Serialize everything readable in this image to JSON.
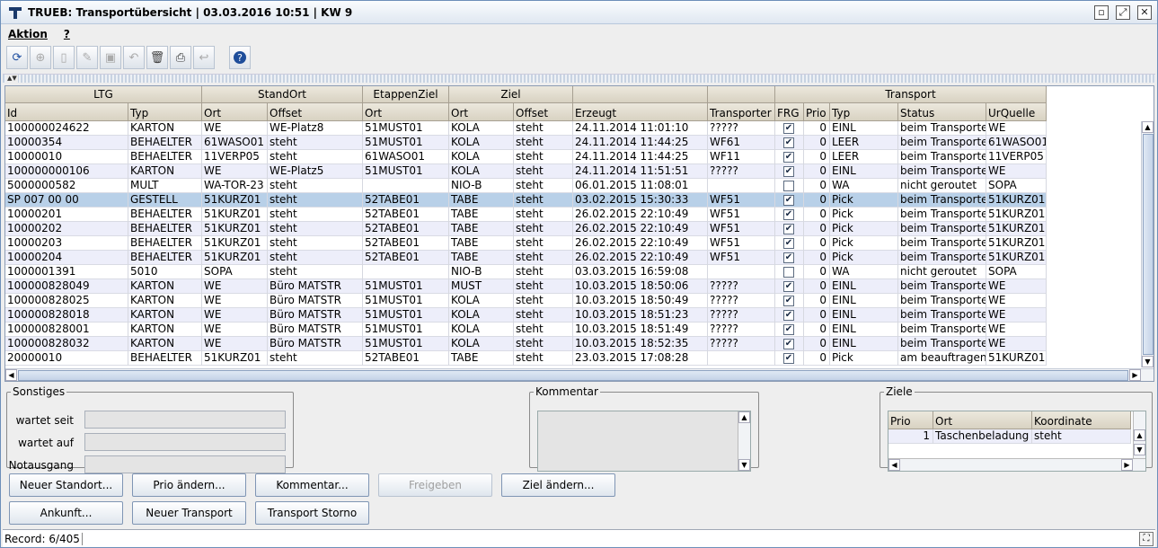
{
  "window": {
    "title": "TRUEB: Transportübersicht | 03.03.2016 10:51 | KW 9"
  },
  "menu": [
    "Aktion",
    "?"
  ],
  "table": {
    "group_headers": [
      "LTG",
      "StandOrt",
      "EtappenZiel",
      "Ziel",
      "Transport"
    ],
    "columns": [
      "Id",
      "Typ",
      "Ort",
      "Offset",
      "Ort",
      "Ort",
      "Offset",
      "Erzeugt",
      "Transporter",
      "FRG",
      "Prio",
      "Typ",
      "Status",
      "UrQuelle"
    ],
    "rows": [
      [
        "100000024622",
        "KARTON",
        "WE",
        "WE-Platz8",
        "51MUST01",
        "KOLA",
        "steht",
        "24.11.2014 11:01:10",
        "?????",
        true,
        "0",
        "EINL",
        "beim Transporter",
        "WE"
      ],
      [
        "10000354",
        "BEHAELTER",
        "61WASO01",
        "steht",
        "51MUST01",
        "KOLA",
        "steht",
        "24.11.2014 11:44:25",
        "WF61",
        true,
        "0",
        "LEER",
        "beim Transporter",
        "61WASO01"
      ],
      [
        "10000010",
        "BEHAELTER",
        "11VERP05",
        "steht",
        "61WASO01",
        "KOLA",
        "steht",
        "24.11.2014 11:44:25",
        "WF11",
        true,
        "0",
        "LEER",
        "beim Transporter",
        "11VERP05"
      ],
      [
        "100000000106",
        "KARTON",
        "WE",
        "WE-Platz5",
        "51MUST01",
        "KOLA",
        "steht",
        "24.11.2014 11:51:51",
        "?????",
        true,
        "0",
        "EINL",
        "beim Transporter",
        "WE"
      ],
      [
        "5000000582",
        "MULT",
        "WA-TOR-23",
        "steht",
        "",
        "NIO-B",
        "steht",
        "06.01.2015 11:08:01",
        "",
        false,
        "0",
        "WA",
        "nicht geroutet",
        "SOPA"
      ],
      [
        "SP 007 00 00",
        "GESTELL",
        "51KURZ01",
        "steht",
        "52TABE01",
        "TABE",
        "steht",
        "03.02.2015 15:30:33",
        "WF51",
        true,
        "0",
        "Pick",
        "beim Transporter",
        "51KURZ01"
      ],
      [
        "10000201",
        "BEHAELTER",
        "51KURZ01",
        "steht",
        "52TABE01",
        "TABE",
        "steht",
        "26.02.2015 22:10:49",
        "WF51",
        true,
        "0",
        "Pick",
        "beim Transporter",
        "51KURZ01"
      ],
      [
        "10000202",
        "BEHAELTER",
        "51KURZ01",
        "steht",
        "52TABE01",
        "TABE",
        "steht",
        "26.02.2015 22:10:49",
        "WF51",
        true,
        "0",
        "Pick",
        "beim Transporter",
        "51KURZ01"
      ],
      [
        "10000203",
        "BEHAELTER",
        "51KURZ01",
        "steht",
        "52TABE01",
        "TABE",
        "steht",
        "26.02.2015 22:10:49",
        "WF51",
        true,
        "0",
        "Pick",
        "beim Transporter",
        "51KURZ01"
      ],
      [
        "10000204",
        "BEHAELTER",
        "51KURZ01",
        "steht",
        "52TABE01",
        "TABE",
        "steht",
        "26.02.2015 22:10:49",
        "WF51",
        true,
        "0",
        "Pick",
        "beim Transporter",
        "51KURZ01"
      ],
      [
        "1000001391",
        "5010",
        "SOPA",
        "steht",
        "",
        "NIO-B",
        "steht",
        "03.03.2015 16:59:08",
        "",
        false,
        "0",
        "WA",
        "nicht geroutet",
        "SOPA"
      ],
      [
        "100000828049",
        "KARTON",
        "WE",
        "Büro MATSTR",
        "51MUST01",
        "MUST",
        "steht",
        "10.03.2015 18:50:06",
        "?????",
        true,
        "0",
        "EINL",
        "beim Transporter",
        "WE"
      ],
      [
        "100000828025",
        "KARTON",
        "WE",
        "Büro MATSTR",
        "51MUST01",
        "KOLA",
        "steht",
        "10.03.2015 18:50:49",
        "?????",
        true,
        "0",
        "EINL",
        "beim Transporter",
        "WE"
      ],
      [
        "100000828018",
        "KARTON",
        "WE",
        "Büro MATSTR",
        "51MUST01",
        "KOLA",
        "steht",
        "10.03.2015 18:51:23",
        "?????",
        true,
        "0",
        "EINL",
        "beim Transporter",
        "WE"
      ],
      [
        "100000828001",
        "KARTON",
        "WE",
        "Büro MATSTR",
        "51MUST01",
        "KOLA",
        "steht",
        "10.03.2015 18:51:49",
        "?????",
        true,
        "0",
        "EINL",
        "beim Transporter",
        "WE"
      ],
      [
        "100000828032",
        "KARTON",
        "WE",
        "Büro MATSTR",
        "51MUST01",
        "KOLA",
        "steht",
        "10.03.2015 18:52:35",
        "?????",
        true,
        "0",
        "EINL",
        "beim Transporter",
        "WE"
      ],
      [
        "20000010",
        "BEHAELTER",
        "51KURZ01",
        "steht",
        "52TABE01",
        "TABE",
        "steht",
        "23.03.2015 17:08:28",
        "",
        true,
        "0",
        "Pick",
        "am beauftragen",
        "51KURZ01"
      ]
    ],
    "selected_row": 5
  },
  "sonstiges": {
    "title": "Sonstiges",
    "labels": [
      "wartet seit",
      "wartet auf",
      "Notausgang"
    ]
  },
  "kommentar": {
    "title": "Kommentar"
  },
  "ziele": {
    "title": "Ziele",
    "columns": [
      "Prio",
      "Ort",
      "Koordinate"
    ],
    "row": [
      "1",
      "Taschenbeladung",
      "steht"
    ]
  },
  "buttons": {
    "neuer_standort": "Neuer Standort...",
    "prio_aendern": "Prio ändern...",
    "kommentar": "Kommentar...",
    "freigeben": "Freigeben",
    "ziel_aendern": "Ziel ändern...",
    "ankunft": "Ankunft...",
    "neuer_transport": "Neuer Transport",
    "transport_storno": "Transport Storno"
  },
  "status": {
    "record": "Record: 6/405"
  }
}
